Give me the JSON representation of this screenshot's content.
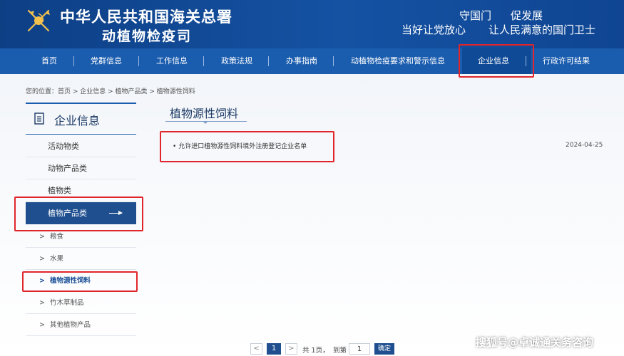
{
  "header": {
    "title_main": "中华人民共和国海关总署",
    "title_sub": "动植物检疫司",
    "slogan_top_left": "守国门",
    "slogan_top_right": "促发展",
    "slogan_bottom_left": "当好让党放心",
    "slogan_bottom_right": "让人民满意的国门卫士"
  },
  "nav": {
    "items": [
      "首页",
      "党群信息",
      "工作信息",
      "政策法规",
      "办事指南",
      "动植物检疫要求和警示信息",
      "企业信息",
      "行政许可结果"
    ],
    "separator": "|",
    "active": "企业信息"
  },
  "breadcrumb": "您的位置：首页 > 企业信息 > 植物产品类 > 植物源性饲料",
  "sidebar": {
    "title": "企业信息",
    "items": [
      "活动物类",
      "动物产品类",
      "植物类",
      "植物产品类"
    ],
    "active": "植物产品类",
    "sub_items": [
      "粮食",
      "水果",
      "植物源性饲料",
      "竹木草制品",
      "其他植物产品"
    ],
    "sub_chevron": ">",
    "current_sub": "植物源性饲料"
  },
  "content": {
    "title": "植物源性饲料",
    "list": [
      {
        "title": "允许进口植物源性饲料境外注册登记企业名单",
        "date": "2024-04-25"
      }
    ]
  },
  "pagination": {
    "prev": "<",
    "current": "1",
    "next": ">",
    "total_text": "共 1页，",
    "goto_label": "到第",
    "goto_value": "1",
    "confirm": "确定"
  },
  "watermark": "搜狐号@卓诚通关务咨询",
  "colors": {
    "header_bg": "#1552a3",
    "nav_bg": "#1a5cae",
    "sidebar_active": "#1f4f8f",
    "highlight_red": "#e0262b"
  }
}
